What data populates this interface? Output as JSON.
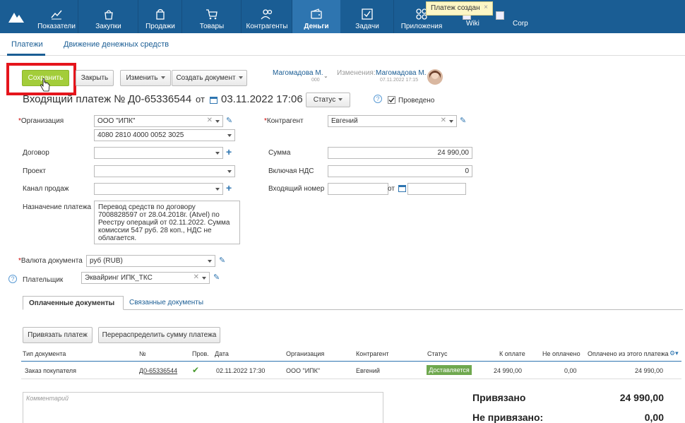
{
  "nav": {
    "items": [
      {
        "label": "Показатели",
        "icon": "chart-icon"
      },
      {
        "label": "Закупки",
        "icon": "bag-icon"
      },
      {
        "label": "Продажи",
        "icon": "shopping-bag-icon"
      },
      {
        "label": "Товары",
        "icon": "cart-icon"
      },
      {
        "label": "Контрагенты",
        "icon": "people-icon"
      },
      {
        "label": "Деньги",
        "icon": "wallet-icon"
      },
      {
        "label": "Задачи",
        "icon": "checkbox-icon"
      },
      {
        "label": "Приложения",
        "icon": "apps-icon"
      },
      {
        "label": "Wiki",
        "icon": "broken-image-icon"
      },
      {
        "label": "Corp",
        "icon": "broken-image-icon"
      }
    ],
    "active": "Деньги",
    "toast": "Платеж создан",
    "toast_close": "×"
  },
  "subtabs": [
    "Платежи",
    "Движение денежных средств"
  ],
  "toolbar": {
    "save": "Сохранить",
    "close": "Закрыть",
    "edit": "Изменить",
    "create_doc": "Создать документ"
  },
  "owner": {
    "name": "Магомадова М.",
    "sub": "000"
  },
  "changes": {
    "label": "Изменения:",
    "name": "Магомадова М.",
    "date": "07.11.2022 17:15"
  },
  "doc": {
    "title": "Входящий платеж №",
    "number": "Д0-65336544",
    "from": "от",
    "date": "03.11.2022 17:06",
    "status_btn": "Статус",
    "posted_label": "Проведено",
    "posted": true
  },
  "form": {
    "org_label": "Организация",
    "org_value": "ООО \"ИПК\"",
    "account_value": "4080 2810 4000 0052 3025",
    "contract_label": "Договор",
    "project_label": "Проект",
    "channel_label": "Канал продаж",
    "purpose_label": "Назначение платежа",
    "purpose_value": "Перевод средств по договору 7008828597 от 28.04.2018г. (Atvel) по Реестру операций от 02.11.2022. Сумма комиссии 547 руб. 28 коп., НДС не облагается.",
    "currency_label": "Валюта документа",
    "currency_value": "руб (RUB)",
    "payer_label": "Плательщик",
    "payer_value": "Эквайринг ИПК_ТКС",
    "contractor_label": "Контрагент",
    "contractor_value": "Евгений",
    "sum_label": "Сумма",
    "sum_value": "24 990,00",
    "vat_label": "Включая НДС",
    "vat_value": "0",
    "incoming_label": "Входящий номер",
    "incoming_from": "от"
  },
  "doc_tabs": [
    "Оплаченные документы",
    "Связанные документы"
  ],
  "buttons": {
    "bind": "Привязать платеж",
    "redistribute": "Перераспределить сумму платежа"
  },
  "table": {
    "headers": [
      "Тип документа",
      "№",
      "Пров.",
      "Дата",
      "Организация",
      "Контрагент",
      "Статус",
      "К оплате",
      "Не оплачено",
      "Оплачено из этого платежа"
    ],
    "row": {
      "type": "Заказ покупателя",
      "number": "Д0-65336544",
      "posted": "✔",
      "date": "02.11.2022 17:30",
      "org": "ООО \"ИПК\"",
      "contractor": "Евгений",
      "status": "Доставляется",
      "to_pay": "24 990,00",
      "unpaid": "0,00",
      "paid": "24 990,00"
    }
  },
  "comment_placeholder": "Комментарий",
  "totals": {
    "bound_label": "Привязано",
    "bound_value": "24 990,00",
    "unbound_label": "Не привязано:",
    "unbound_value": "0,00"
  }
}
